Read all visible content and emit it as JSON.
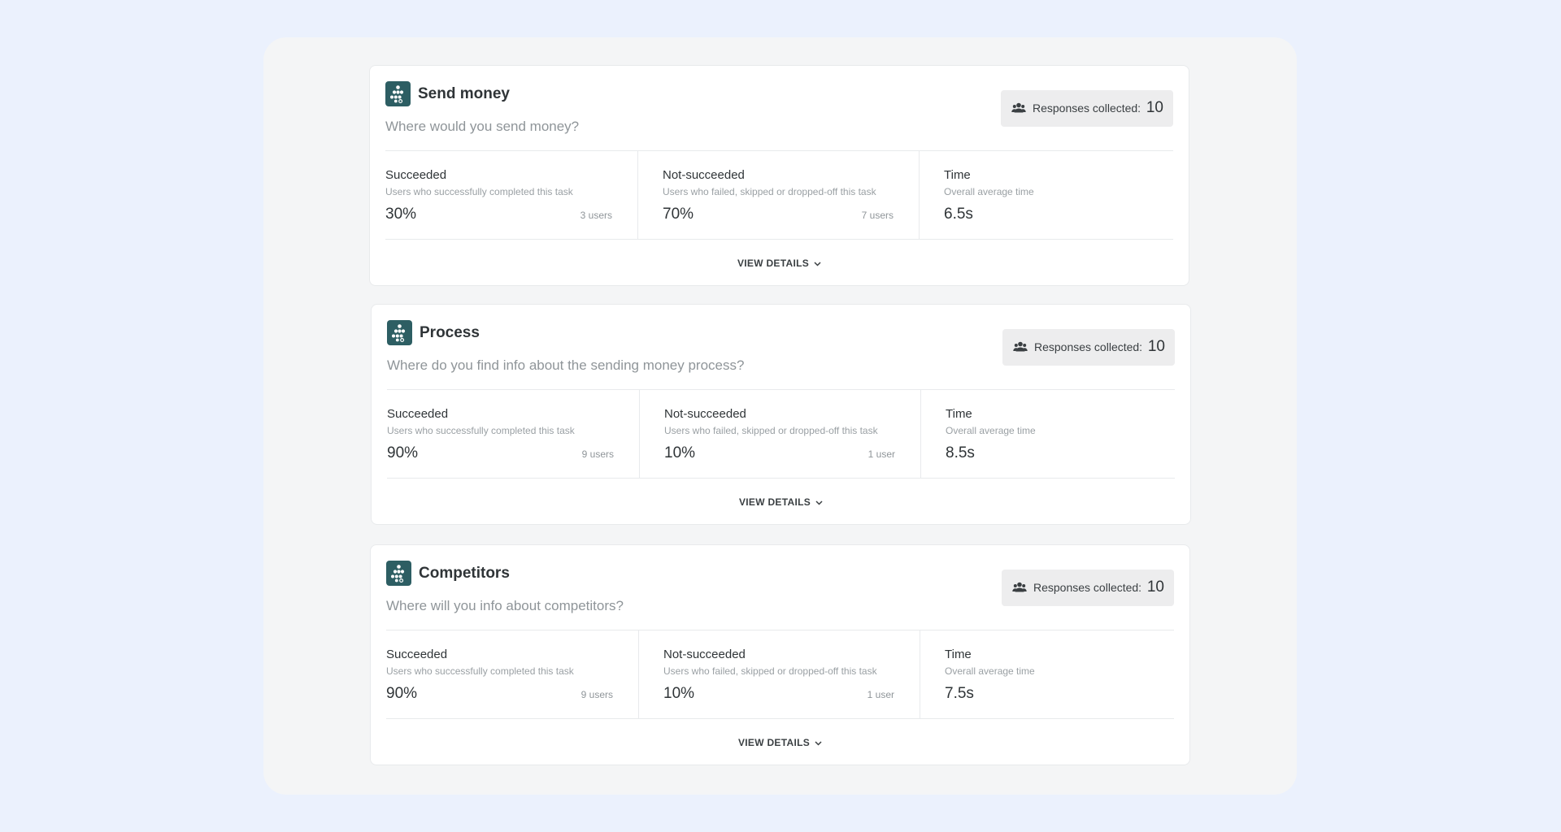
{
  "responses_label": "Responses collected:",
  "metric_labels": {
    "succeeded_title": "Succeeded",
    "succeeded_desc": "Users who successfully completed this task",
    "not_succeeded_title": "Not-succeeded",
    "not_succeeded_desc": "Users who failed, skipped or dropped-off this task",
    "time_title": "Time",
    "time_desc": "Overall average time"
  },
  "view_details_label": "VIEW DETAILS",
  "colors": {
    "page_background": "#ebf1fd",
    "panel_background": "#f4f5f6",
    "task_icon": "#2d5e63",
    "responses_badge": "#ededee"
  },
  "icons": {
    "task": "tree-structure-icon",
    "responses": "users-icon",
    "view_details": "chevron-down-icon"
  },
  "tasks": [
    {
      "title": "Send money",
      "question": "Where would you send money?",
      "responses_collected": "10",
      "succeeded_pct": "30%",
      "succeeded_users": "3 users",
      "not_succeeded_pct": "70%",
      "not_succeeded_users": "7 users",
      "avg_time": "6.5s"
    },
    {
      "title": "Process",
      "question": "Where do you find info about the sending money process?",
      "responses_collected": "10",
      "succeeded_pct": "90%",
      "succeeded_users": "9 users",
      "not_succeeded_pct": "10%",
      "not_succeeded_users": "1 user",
      "avg_time": "8.5s"
    },
    {
      "title": "Competitors",
      "question": "Where will you info about competitors?",
      "responses_collected": "10",
      "succeeded_pct": "90%",
      "succeeded_users": "9 users",
      "not_succeeded_pct": "10%",
      "not_succeeded_users": "1 user",
      "avg_time": "7.5s"
    }
  ]
}
